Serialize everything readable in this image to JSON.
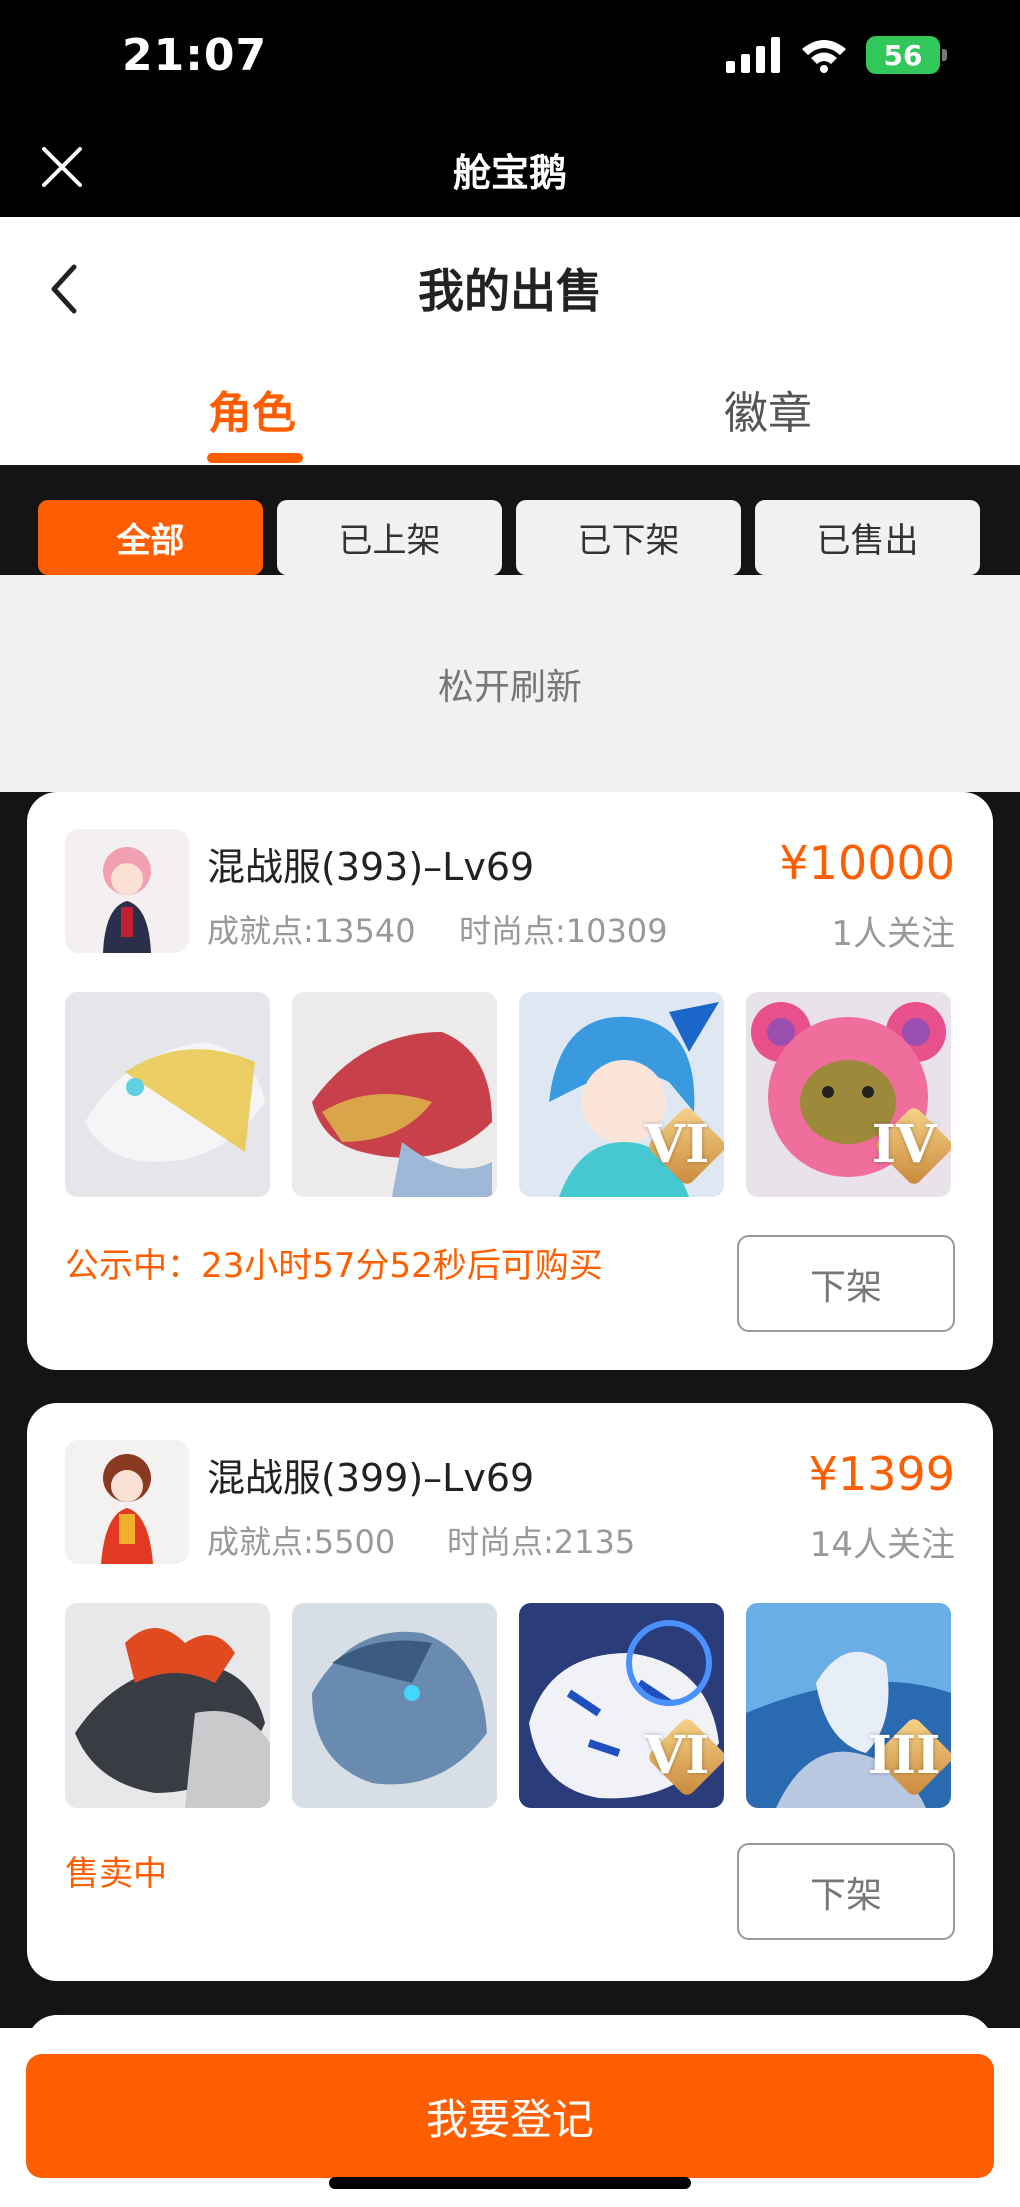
{
  "status_bar": {
    "time": "21:07",
    "battery": "56"
  },
  "app_header": {
    "title": "舱宝鹅"
  },
  "page_header": {
    "title": "我的出售"
  },
  "tabs": [
    {
      "label": "角色",
      "active": true
    },
    {
      "label": "徽章",
      "active": false
    }
  ],
  "filters": [
    {
      "label": "全部",
      "active": true
    },
    {
      "label": "已上架",
      "active": false
    },
    {
      "label": "已下架",
      "active": false
    },
    {
      "label": "已售出",
      "active": false
    }
  ],
  "refresh_text": "松开刷新",
  "listings": [
    {
      "name": "混战服(393)–Lv69",
      "achievement": "成就点:13540",
      "fashion": "时尚点:10309",
      "price": "¥10000",
      "followers": "1人关注",
      "thumbs": [
        {
          "icon": "white-gold-dragon-mount",
          "tier": ""
        },
        {
          "icon": "red-dragon-mount",
          "tier": ""
        },
        {
          "icon": "blue-hair-character",
          "tier": "VI"
        },
        {
          "icon": "pink-bear-costume",
          "tier": "IV"
        }
      ],
      "status": "公示中：23小时57分52秒后可购买",
      "action": "下架"
    },
    {
      "name": "混战服(399)–Lv69",
      "achievement": "成就点:5500",
      "fashion": "时尚点:2135",
      "price": "¥1399",
      "followers": "14人关注",
      "thumbs": [
        {
          "icon": "black-dragon-mount",
          "tier": ""
        },
        {
          "icon": "blue-horse-mount",
          "tier": ""
        },
        {
          "icon": "white-tiger-mount",
          "tier": "VI"
        },
        {
          "icon": "ice-knight-character",
          "tier": "III"
        }
      ],
      "status": "售卖中",
      "action": "下架"
    }
  ],
  "register_button": "我要登记",
  "colors": {
    "accent": "#ff5e00",
    "muted": "#999999"
  }
}
